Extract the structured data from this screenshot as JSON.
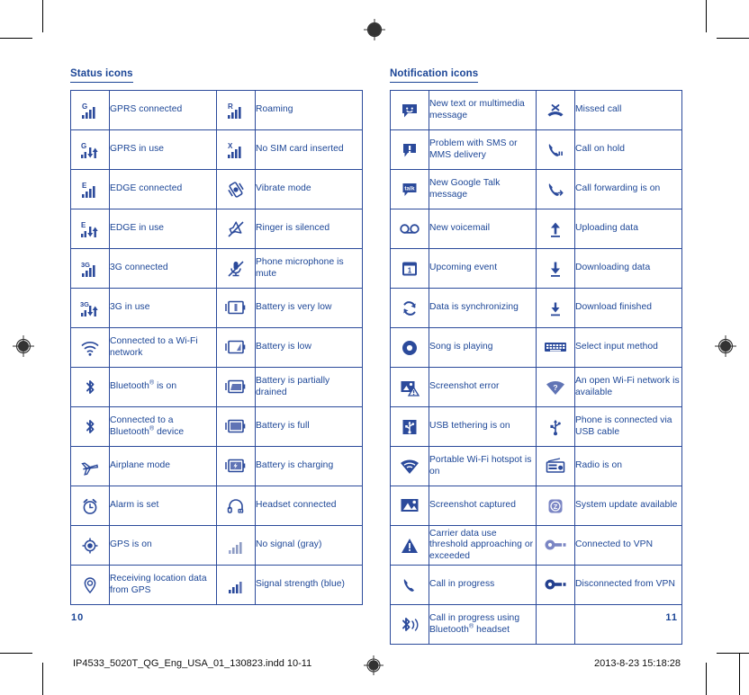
{
  "document": {
    "left_page_number": "10",
    "right_page_number": "11",
    "print_filename": "IP4533_5020T_QG_Eng_USA_01_130823.indd   10-11",
    "print_timestamp": "2013-8-23   15:18:28"
  },
  "colors": {
    "text_blue": "#1b4596",
    "icon_blue": "#2b4a9b",
    "icon_gray": "#8e9cc4",
    "border_blue": "#2b4a9b",
    "vpn_light": "#7b86c4"
  },
  "status_section": {
    "title": "Status icons",
    "rows": [
      {
        "icon_a": "gprs-connected-icon",
        "label_a": "GPRS connected",
        "icon_b": "roaming-icon",
        "label_b": "Roaming"
      },
      {
        "icon_a": "gprs-in-use-icon",
        "label_a": "GPRS in use",
        "icon_b": "no-sim-card-icon",
        "label_b": "No SIM card inserted"
      },
      {
        "icon_a": "edge-connected-icon",
        "label_a": "EDGE connected",
        "icon_b": "vibrate-mode-icon",
        "label_b": "Vibrate mode"
      },
      {
        "icon_a": "edge-in-use-icon",
        "label_a": "EDGE in use",
        "icon_b": "ringer-silenced-icon",
        "label_b": "Ringer is silenced"
      },
      {
        "icon_a": "3g-connected-icon",
        "label_a": "3G connected",
        "icon_b": "microphone-mute-icon",
        "label_b": "Phone microphone is mute"
      },
      {
        "icon_a": "3g-in-use-icon",
        "label_a": "3G in use",
        "icon_b": "battery-very-low-icon",
        "label_b": "Battery is very low"
      },
      {
        "icon_a": "wifi-connected-icon",
        "label_a": "Connected to a Wi-Fi network",
        "icon_b": "battery-low-icon",
        "label_b": "Battery is low"
      },
      {
        "icon_a": "bluetooth-on-icon",
        "label_a": "Bluetooth® is on",
        "icon_b": "battery-partial-icon",
        "label_b": "Battery is partially drained"
      },
      {
        "icon_a": "bluetooth-connected-icon",
        "label_a": "Connected to a Bluetooth® device",
        "icon_b": "battery-full-icon",
        "label_b": "Battery is full"
      },
      {
        "icon_a": "airplane-mode-icon",
        "label_a": "Airplane mode",
        "icon_b": "battery-charging-icon",
        "label_b": "Battery is charging"
      },
      {
        "icon_a": "alarm-set-icon",
        "label_a": "Alarm is set",
        "icon_b": "headset-connected-icon",
        "label_b": "Headset connected"
      },
      {
        "icon_a": "gps-on-icon",
        "label_a": "GPS is on",
        "icon_b": "no-signal-gray-icon",
        "label_b": "No signal (gray)"
      },
      {
        "icon_a": "gps-receiving-icon",
        "label_a": "Receiving location data from GPS",
        "icon_b": "signal-strength-blue-icon",
        "label_b": "Signal strength (blue)"
      }
    ]
  },
  "notification_section": {
    "title": "Notification icons",
    "rows": [
      {
        "icon_a": "new-message-icon",
        "label_a": "New text or multimedia message",
        "icon_b": "missed-call-icon",
        "label_b": "Missed call"
      },
      {
        "icon_a": "message-problem-icon",
        "label_a": "Problem with SMS or MMS delivery",
        "icon_b": "call-on-hold-icon",
        "label_b": "Call on hold"
      },
      {
        "icon_a": "google-talk-icon",
        "label_a": "New Google Talk message",
        "icon_b": "call-forwarding-icon",
        "label_b": "Call forwarding is on"
      },
      {
        "icon_a": "voicemail-icon",
        "label_a": "New voicemail",
        "icon_b": "uploading-data-icon",
        "label_b": "Uploading data"
      },
      {
        "icon_a": "upcoming-event-icon",
        "label_a": "Upcoming event",
        "icon_b": "downloading-data-icon",
        "label_b": "Downloading data"
      },
      {
        "icon_a": "data-sync-icon",
        "label_a": "Data is synchronizing",
        "icon_b": "download-finished-icon",
        "label_b": "Download finished"
      },
      {
        "icon_a": "song-playing-icon",
        "label_a": "Song is playing",
        "icon_b": "input-method-icon",
        "label_b": "Select input method"
      },
      {
        "icon_a": "screenshot-error-icon",
        "label_a": "Screenshot error",
        "icon_b": "open-wifi-icon",
        "label_b": "An open Wi-Fi network is available"
      },
      {
        "icon_a": "usb-tethering-icon",
        "label_a": "USB tethering is on",
        "icon_b": "usb-connected-icon",
        "label_b": "Phone is connected via USB cable"
      },
      {
        "icon_a": "wifi-hotspot-icon",
        "label_a": "Portable Wi-Fi hotspot is on",
        "icon_b": "radio-on-icon",
        "label_b": "Radio is on"
      },
      {
        "icon_a": "screenshot-captured-icon",
        "label_a": "Screenshot captured",
        "icon_b": "system-update-icon",
        "label_b": "System update available"
      },
      {
        "icon_a": "data-warning-icon",
        "label_a": "Carrier data use threshold approaching or exceeded",
        "icon_b": "vpn-connected-icon",
        "label_b": "Connected to VPN"
      },
      {
        "icon_a": "call-in-progress-icon",
        "label_a": "Call in progress",
        "icon_b": "vpn-disconnected-icon",
        "label_b": "Disconnected from VPN"
      },
      {
        "icon_a": "bluetooth-call-icon",
        "label_a": "Call in progress using Bluetooth® headset",
        "icon_b": "",
        "label_b": ""
      }
    ]
  }
}
